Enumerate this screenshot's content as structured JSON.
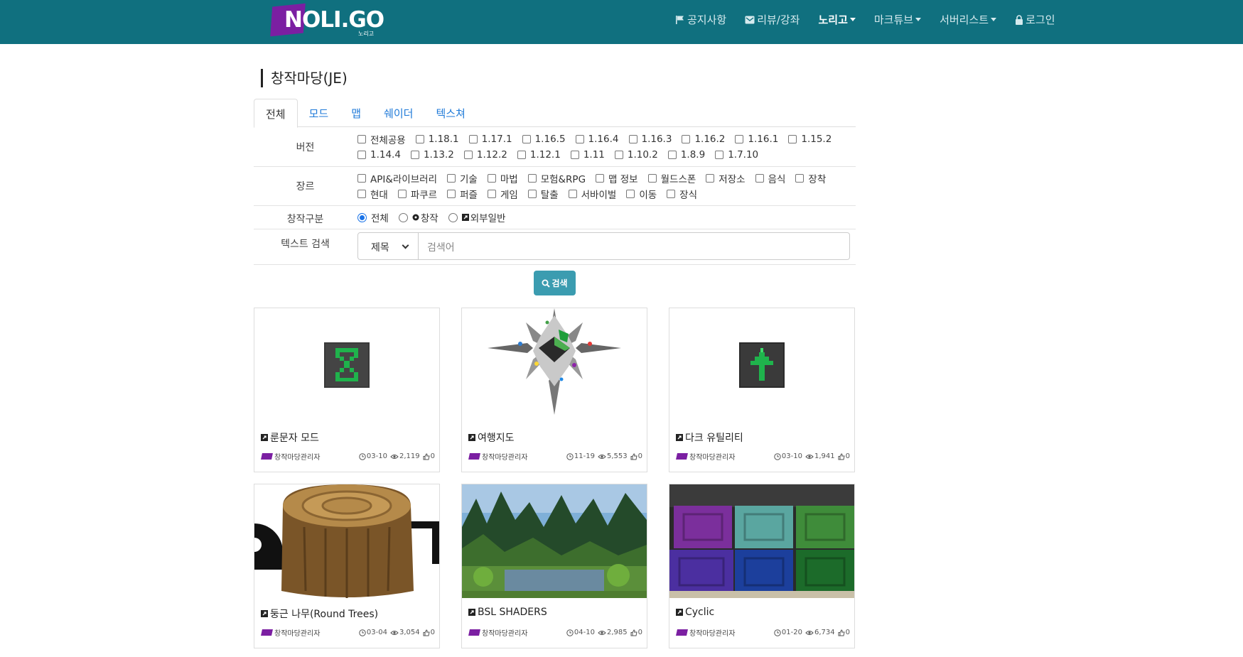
{
  "brand": {
    "logo_text": "NOLI.GO",
    "logo_sub": "노리고",
    "brand_color": "#7b1fa2",
    "nav_color": "#10707f"
  },
  "nav": [
    {
      "label": "공지사항",
      "icon": "flag-icon",
      "dropdown": false,
      "active": false
    },
    {
      "label": "리뷰/강좌",
      "icon": "envelope-icon",
      "dropdown": false,
      "active": false
    },
    {
      "label": "노리고",
      "icon": "",
      "dropdown": true,
      "active": true
    },
    {
      "label": "마크튜브",
      "icon": "",
      "dropdown": true,
      "active": false
    },
    {
      "label": "서버리스트",
      "icon": "",
      "dropdown": true,
      "active": false
    },
    {
      "label": "로그인",
      "icon": "lock-icon",
      "dropdown": false,
      "active": false
    }
  ],
  "page": {
    "title": "창작마당(JE)"
  },
  "tabs": [
    "전체",
    "모드",
    "맵",
    "쉐이더",
    "텍스쳐"
  ],
  "filters": {
    "version": {
      "label": "버전",
      "options": [
        "전체공용",
        "1.18.1",
        "1.17.1",
        "1.16.5",
        "1.16.4",
        "1.16.3",
        "1.16.2",
        "1.16.1",
        "1.15.2",
        "1.14.4",
        "1.13.2",
        "1.12.2",
        "1.12.1",
        "1.11",
        "1.10.2",
        "1.8.9",
        "1.7.10"
      ]
    },
    "genre": {
      "label": "장르",
      "options": [
        "API&라이브러리",
        "기술",
        "마법",
        "모험&RPG",
        "맵 정보",
        "월드스폰",
        "저장소",
        "음식",
        "장착",
        "현대",
        "파쿠르",
        "퍼즐",
        "게임",
        "탈출",
        "서바이벌",
        "이동",
        "장식"
      ]
    },
    "category": {
      "label": "창작구분",
      "options": [
        "전체",
        "창작",
        "외부일반"
      ],
      "selected": "전체"
    },
    "text_search": {
      "label": "텍스트 검색",
      "select_value": "제목",
      "placeholder": "검색어"
    }
  },
  "search_button": "검색",
  "cards": [
    {
      "title": "룬문자 모드",
      "author": "창작마당관리자",
      "date": "03-10",
      "views": "2,119",
      "likes": "0"
    },
    {
      "title": "여행지도",
      "author": "창작마당관리자",
      "date": "11-19",
      "views": "5,553",
      "likes": "0"
    },
    {
      "title": "다크 유틸리티",
      "author": "창작마당관리자",
      "date": "03-10",
      "views": "1,941",
      "likes": "0"
    },
    {
      "title": "둥근 나무(Round Trees)",
      "author": "창작마당관리자",
      "date": "03-04",
      "views": "3,054",
      "likes": "0"
    },
    {
      "title": "BSL SHADERS",
      "author": "창작마당관리자",
      "date": "04-10",
      "views": "2,985",
      "likes": "0"
    },
    {
      "title": "Cyclic",
      "author": "창작마당관리자",
      "date": "01-20",
      "views": "6,734",
      "likes": "0"
    }
  ]
}
